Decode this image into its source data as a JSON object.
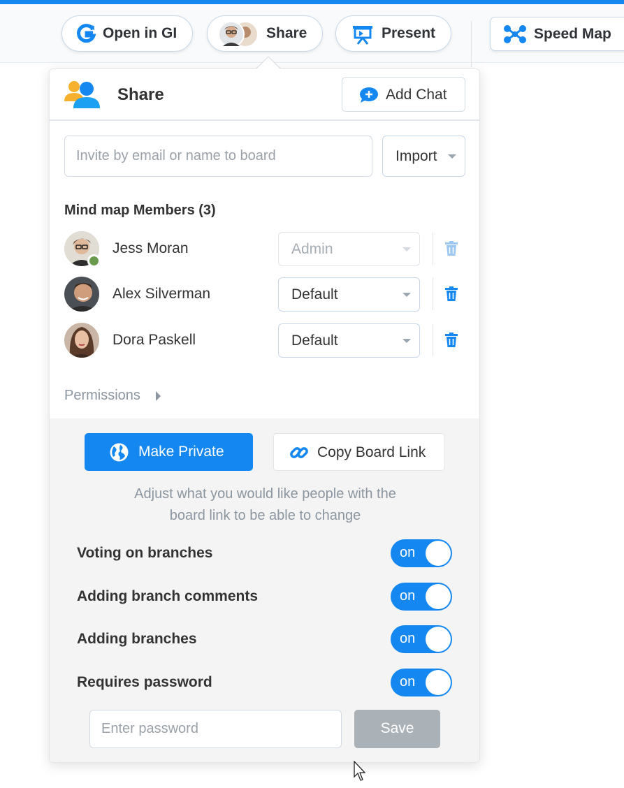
{
  "toolbar": {
    "open_in_gi": "Open in GI",
    "share": "Share",
    "present": "Present",
    "speed_map": "Speed Map"
  },
  "panel": {
    "title": "Share",
    "add_chat": "Add Chat",
    "invite_placeholder": "Invite by email or name to board",
    "import_label": "Import",
    "members_heading": "Mind map Members (3)",
    "members": [
      {
        "name": "Jess Moran",
        "role": "Admin",
        "role_disabled": true,
        "online": true
      },
      {
        "name": "Alex Silverman",
        "role": "Default",
        "role_disabled": false,
        "online": false
      },
      {
        "name": "Dora Paskell",
        "role": "Default",
        "role_disabled": false,
        "online": false
      }
    ],
    "permissions_label": "Permissions",
    "make_private": "Make Private",
    "copy_board_link": "Copy Board Link",
    "hint_line1": "Adjust what you would like people with the",
    "hint_line2": "board link to be able to change",
    "options": [
      {
        "label": "Voting on branches",
        "state": "on"
      },
      {
        "label": "Adding branch comments",
        "state": "on"
      },
      {
        "label": "Adding branches",
        "state": "on"
      },
      {
        "label": "Requires password",
        "state": "on"
      }
    ],
    "password_placeholder": "Enter password",
    "save_label": "Save"
  },
  "colors": {
    "accent": "#1488f0",
    "save_disabled": "#aab2b8",
    "online": "#6a9a4e"
  }
}
